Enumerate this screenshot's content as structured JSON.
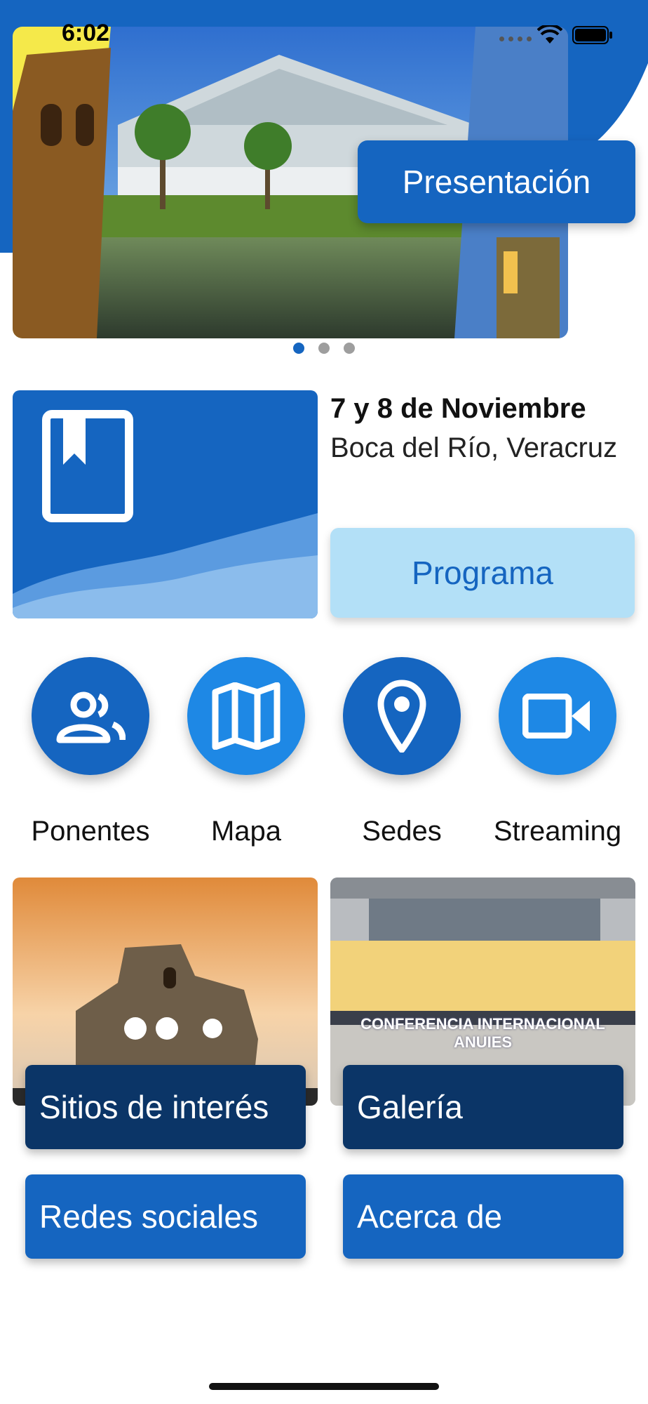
{
  "status_bar": {
    "time": "6:02"
  },
  "hero": {
    "button_label": "Presentación",
    "pages": 3,
    "active_page": 1
  },
  "event": {
    "date": "7 y 8 de Noviembre",
    "place": "Boca del Río, Veracruz",
    "program_label": "Programa"
  },
  "quick_nav": [
    {
      "label": "Ponentes",
      "icon": "people-icon"
    },
    {
      "label": "Mapa",
      "icon": "map-icon"
    },
    {
      "label": "Sedes",
      "icon": "location-pin-icon"
    },
    {
      "label": "Streaming",
      "icon": "video-camera-icon"
    }
  ],
  "tiles": {
    "sitios": "Sitios de interés",
    "galeria": "Galería",
    "galeria_banner": "CONFERENCIA INTERNACIONAL ANUIES",
    "redes": "Redes sociales",
    "acerca": "Acerca de"
  },
  "colors": {
    "primary": "#1565c0",
    "secondary": "#1e88e5",
    "navy": "#0b3567",
    "light_blue": "#b3e0f7"
  }
}
